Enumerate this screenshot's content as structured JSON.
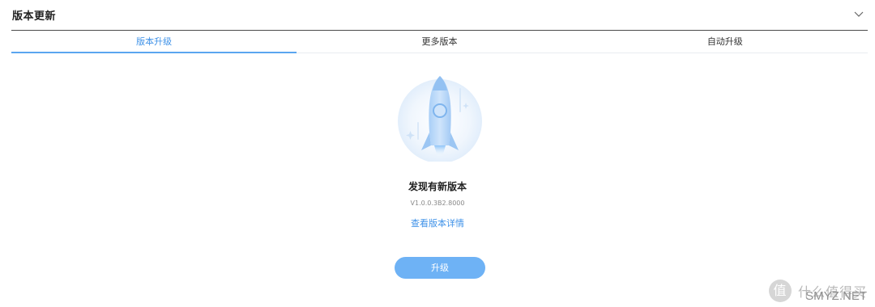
{
  "header": {
    "title": "版本更新"
  },
  "tabs": [
    {
      "label": "版本升级",
      "active": true
    },
    {
      "label": "更多版本",
      "active": false
    },
    {
      "label": "自动升级",
      "active": false
    }
  ],
  "update": {
    "title": "发现有新版本",
    "version": "V1.0.0.3B2.8000",
    "details_link": "查看版本详情",
    "upgrade_button": "升级"
  },
  "icons": {
    "collapse": "chevron-down-icon",
    "illustration": "rocket-icon"
  },
  "watermark": {
    "badge": "值",
    "text": "什么值得买",
    "overlay": "SMYZ.NET"
  },
  "colors": {
    "accent": "#3f92e8",
    "button": "#6eb2f5",
    "header_rule": "#4a4a4a",
    "tab_divider": "#e8ecf1"
  }
}
